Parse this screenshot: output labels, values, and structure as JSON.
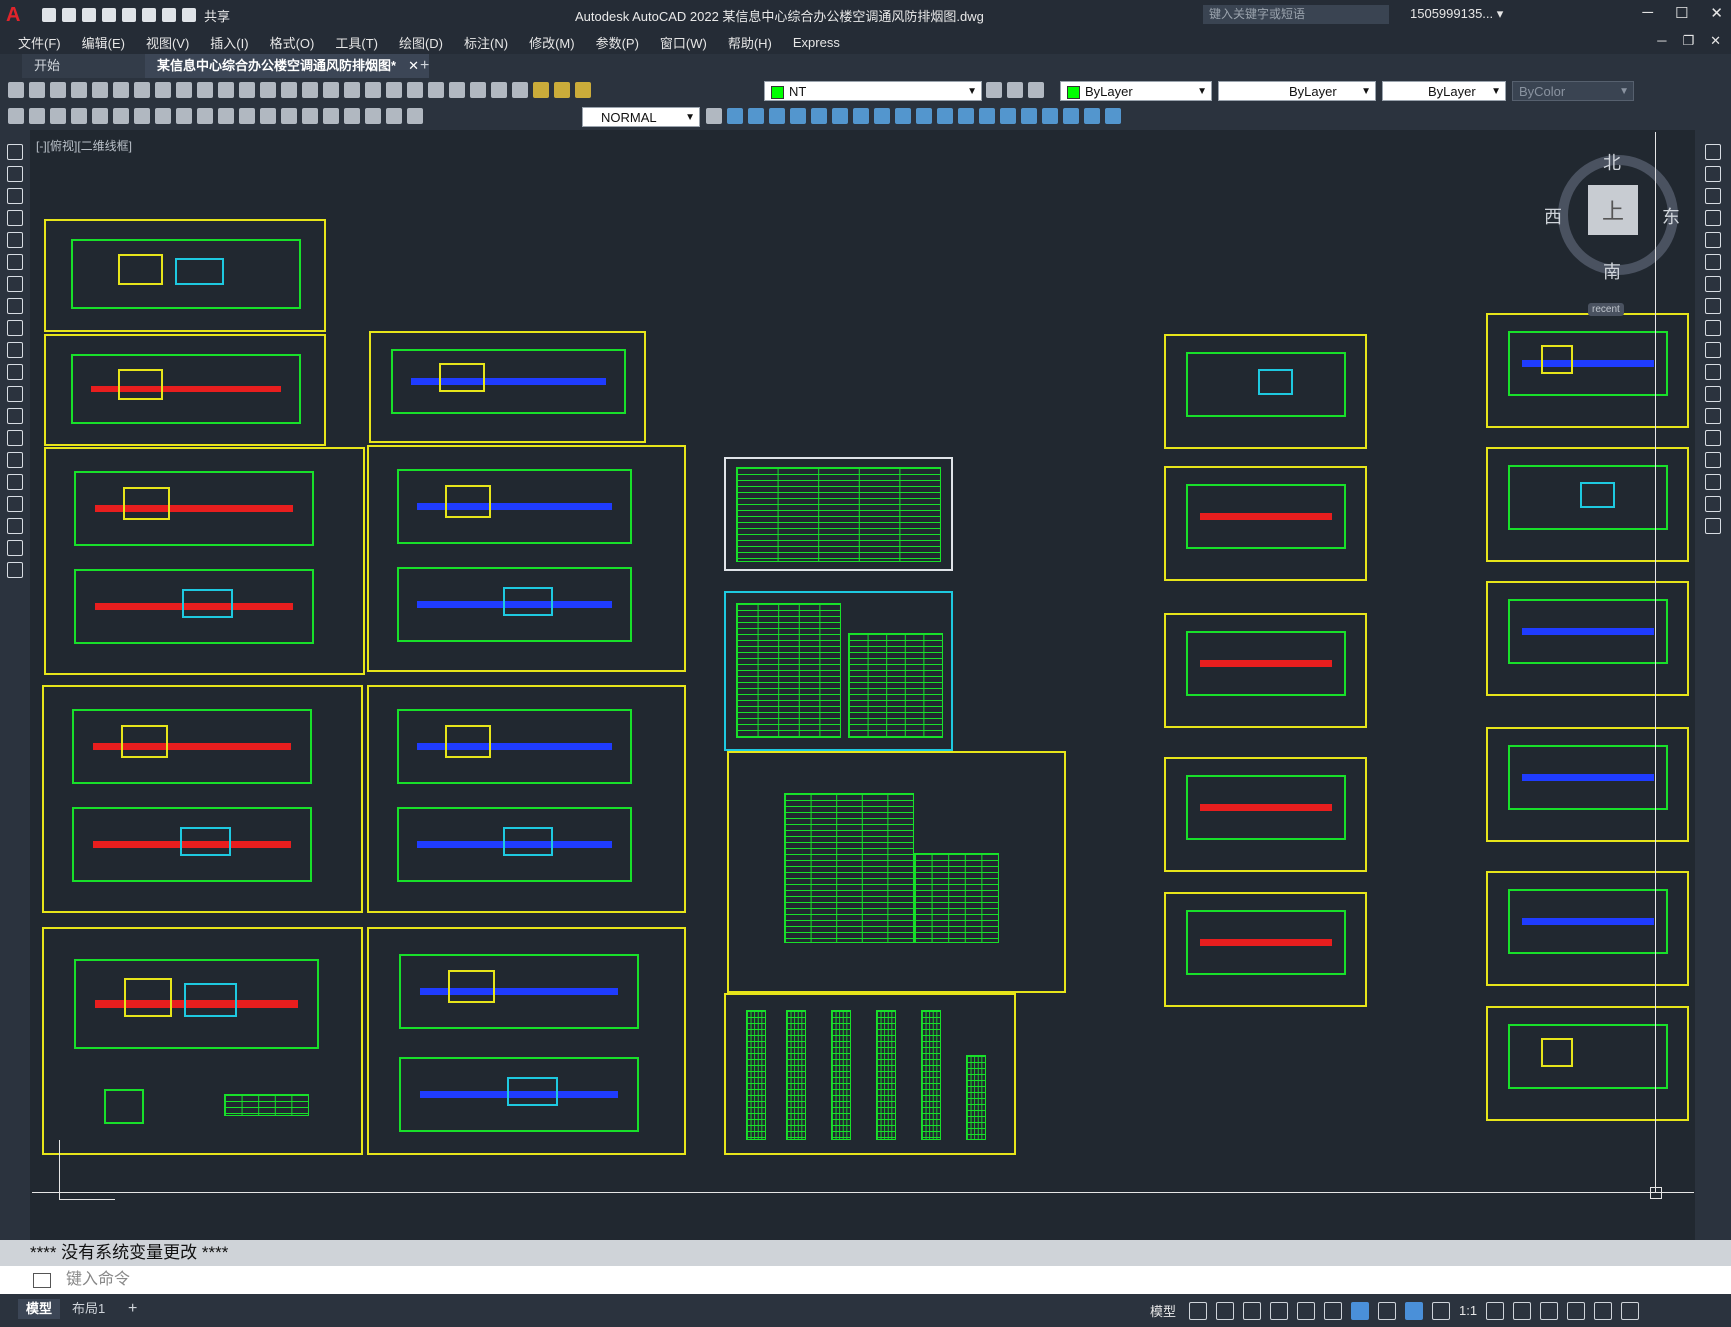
{
  "app": {
    "logo": "A",
    "title": "Autodesk AutoCAD 2022    某信息中心综合办公楼空调通风防排烟图.dwg",
    "share": "共享",
    "search_placeholder": "键入关键字或短语",
    "user": "1505999135... ▾"
  },
  "menu": [
    "文件(F)",
    "编辑(E)",
    "视图(V)",
    "插入(I)",
    "格式(O)",
    "工具(T)",
    "绘图(D)",
    "标注(N)",
    "修改(M)",
    "参数(P)",
    "窗口(W)",
    "帮助(H)",
    "Express"
  ],
  "tabs": {
    "start": "开始",
    "active": "某信息中心综合办公楼空调通风防排烟图*",
    "close": "✕",
    "add": "+"
  },
  "toolbar": {
    "layer": "NT",
    "color": "ByLayer",
    "linetype": "ByLayer",
    "lineweight": "ByLayer",
    "plotstyle": "ByColor",
    "dimstyle": "NORMAL"
  },
  "viewport": {
    "label": "[-][俯视][二维线框]",
    "viewcube": {
      "top": "上",
      "north": "北",
      "south": "南",
      "east": "东",
      "west": "西",
      "recent": "recent"
    }
  },
  "command": {
    "history": "****  没有系统变量更改  ****",
    "placeholder": "键入命令"
  },
  "status": {
    "model_tab": "模型",
    "layout_tab": "布局1",
    "add": "+",
    "model": "模型",
    "scale": "1:1"
  },
  "colors": {
    "frame": "#e7e51a",
    "drawing": "#18e02a",
    "supply": "#e81e1e",
    "return": "#1f3cff",
    "accent": "#1ec9e0"
  }
}
